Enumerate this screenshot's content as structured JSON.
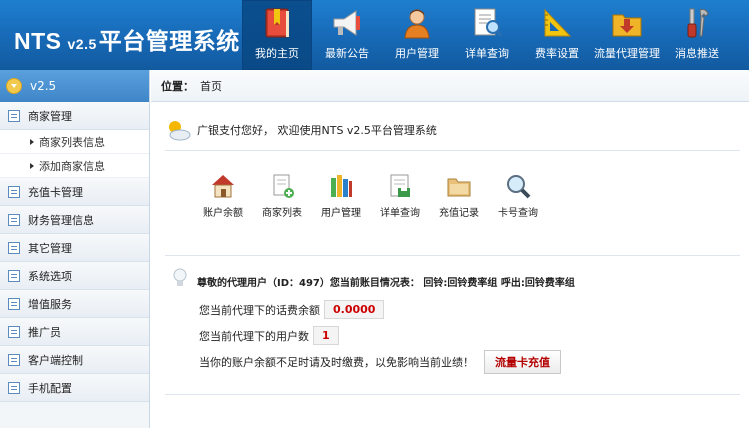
{
  "header": {
    "logo_main": "NTS",
    "logo_version": "v2.5",
    "logo_suffix": "平台管理系统",
    "nav": [
      {
        "label": "我的主页",
        "icon": "book-icon",
        "active": true
      },
      {
        "label": "最新公告",
        "icon": "megaphone-icon",
        "active": false
      },
      {
        "label": "用户管理",
        "icon": "user-icon",
        "active": false
      },
      {
        "label": "详单查询",
        "icon": "document-search-icon",
        "active": false
      },
      {
        "label": "费率设置",
        "icon": "ruler-triangle-icon",
        "active": false
      },
      {
        "label": "流量代理管理",
        "icon": "download-folder-icon",
        "active": false
      },
      {
        "label": "消息推送",
        "icon": "tools-icon",
        "active": false
      }
    ]
  },
  "sidebar": {
    "version": "v2.5",
    "groups": [
      {
        "label": "商家管理",
        "items": [
          "商家列表信息",
          "添加商家信息"
        ]
      },
      {
        "label": "充值卡管理"
      },
      {
        "label": "财务管理信息"
      },
      {
        "label": "其它管理"
      },
      {
        "label": "系统选项"
      },
      {
        "label": "增值服务"
      },
      {
        "label": "推广员"
      },
      {
        "label": "客户端控制"
      },
      {
        "label": "手机配置"
      }
    ]
  },
  "breadcrumb": {
    "label": "位置：",
    "current": "首页"
  },
  "main": {
    "welcome": "广银支付您好， 欢迎使用NTS v2.5平台管理系统",
    "quick_links": [
      {
        "label": "账户余额",
        "icon": "house-icon"
      },
      {
        "label": "商家列表",
        "icon": "document-add-icon"
      },
      {
        "label": "用户管理",
        "icon": "books-icon"
      },
      {
        "label": "详单查询",
        "icon": "save-doc-icon"
      },
      {
        "label": "充值记录",
        "icon": "folder-icon"
      },
      {
        "label": "卡号查询",
        "icon": "magnifier-icon"
      }
    ],
    "agent_title": "尊敬的代理用户（ID：497）您当前账目情况表： 回铃:回铃费率组 呼出:回铃费率组",
    "balance_label": "您当前代理下的话费余额",
    "balance_value": "0.0000",
    "users_label": "您当前代理下的用户数",
    "users_value": "1",
    "notice": "当你的账户余额不足时请及时缴费，以免影响当前业绩！",
    "charge_button": "流量卡充值"
  }
}
